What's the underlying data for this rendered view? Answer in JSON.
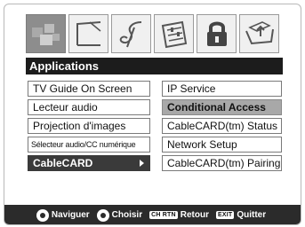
{
  "tabs": [
    {
      "icon": "picture-squares-icon",
      "active": true
    },
    {
      "icon": "screen-frame-icon",
      "active": false
    },
    {
      "icon": "music-clef-icon",
      "active": false
    },
    {
      "icon": "settings-sliders-icon",
      "active": false
    },
    {
      "icon": "lock-icon",
      "active": false
    },
    {
      "icon": "input-tray-icon",
      "active": false
    }
  ],
  "menu": {
    "title": "Applications",
    "left_items": [
      "TV Guide On Screen",
      "Lecteur audio",
      "Projection d'images",
      "Sélecteur audio/CC numérique",
      "CableCARD"
    ],
    "right_items": [
      "IP Service",
      "Conditional Access",
      "CableCARD(tm) Status",
      "Network Setup",
      "CableCARD(tm) Pairing"
    ]
  },
  "navbar": {
    "navigate": "Naviguer",
    "choose": "Choisir",
    "return_key": "CH RTN",
    "return": "Retour",
    "exit_key": "EXIT",
    "quit": "Quitter"
  },
  "colors": {
    "navbar_bg": "#2b2b2b",
    "title_bg": "#1c1c1c",
    "selected_bg": "#3a3a3a",
    "highlight_bg": "#a8a8a8"
  }
}
